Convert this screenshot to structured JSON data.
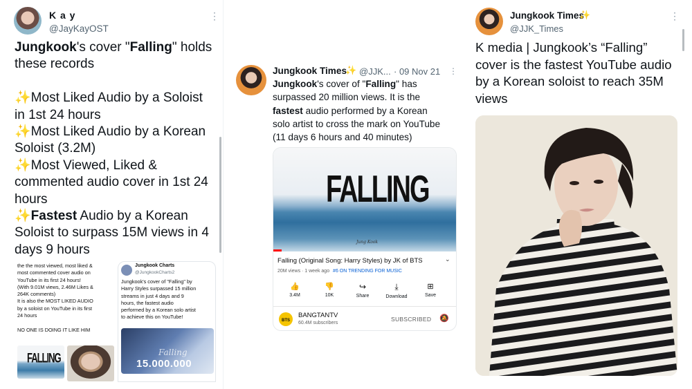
{
  "panel1": {
    "name": "K a y",
    "handle": "@JayKayOST",
    "tweet": {
      "l1a": "Jungkook",
      "l1b": "'s cover \"",
      "l1c": "Falling",
      "l1d": "\" holds",
      "l2": "these records",
      "l4": "Most Liked Audio by a Soloist",
      "l5": "in 1st 24 hours",
      "l6": "Most Liked Audio by a Korean",
      "l7": "Soloist (3.2M)",
      "l8": "Most Viewed, Liked &",
      "l9": "commented audio cover in 1st 24",
      "l10": "hours",
      "l11a": "Fastest",
      "l11b": " Audio by a Korean",
      "l12": "Soloist to surpass 15M views in 4",
      "l13": "days 9 hours"
    },
    "embed_left": {
      "line1": "the the most viewed, most liked &",
      "line2": "most commented cover audio on",
      "line3": "YouTube in its first 24 hours!",
      "line4": "(With 9.01M views, 2.46M Likes &",
      "line5": "264K comments)",
      "line6": "It is also the MOST LIKED AUDIO",
      "line7": "by a soloist on YouTube in its first",
      "line8": "24 hours",
      "line9": "NO ONE IS DOING IT LIKE HIM",
      "thumb_text": "FALLING"
    },
    "embed_right": {
      "name": "Jungkook Charts",
      "handle": "@JungkookCharts2",
      "line1": "Jungkook's cover of \"Falling\" by",
      "line2": "Harry Styles surpassed 15 million",
      "line3": "streams in just 4 days and 9",
      "line4": "hours, the fastest audio",
      "line5": "performed by a Korean solo artist",
      "line6": "to achieve this on YouTube!",
      "image_text": "15.000.000",
      "image_script": "Falling"
    }
  },
  "panel2": {
    "name": "Jungkook Times",
    "handle": "@JJK...",
    "date": "· 09 Nov 21",
    "tweet": {
      "l1a": "Jungkook",
      "l1b": "'s cover of \"",
      "l1c": "Falling",
      "l1d": "\" has",
      "l2": "surpassed 20 million views. It is the",
      "l3a": "fastest",
      "l3b": " audio performed by a Korean",
      "l4": "solo artist to cross the mark on YouTube",
      "l5": "(11 days 6 hours and 40 minutes)"
    },
    "youtube": {
      "thumb_title": "FALLING",
      "thumb_signature": "Jung Kook",
      "video_title": "Falling (Original Song: Harry Styles) by JK of BTS",
      "meta": "20M views · 1 week ago",
      "trending": "#6 ON TRENDING FOR MUSIC",
      "actions": [
        {
          "label": "3.4M",
          "icon": "thumbs-up-icon"
        },
        {
          "label": "10K",
          "icon": "thumbs-down-icon"
        },
        {
          "label": "Share",
          "icon": "share-icon"
        },
        {
          "label": "Download",
          "icon": "download-icon"
        },
        {
          "label": "Save",
          "icon": "save-playlist-icon"
        }
      ],
      "channel_badge": "BTS",
      "channel_name": "BANGTANTV",
      "subscribers": "60.4M subscribers",
      "subscribed": "SUBSCRIBED"
    }
  },
  "panel3": {
    "name": "Jungkook Times",
    "handle": "@JJK_Times",
    "tweet": {
      "l1": "K media | Jungkook’s “Falling”",
      "l2": "cover is the fastest YouTube audio",
      "l3": "by a Korean soloist to reach 35M",
      "l4": "views"
    }
  },
  "colors": {
    "sparkle": "#f2b826",
    "link_blue": "#065fd4",
    "yt_red": "#ff0000"
  }
}
